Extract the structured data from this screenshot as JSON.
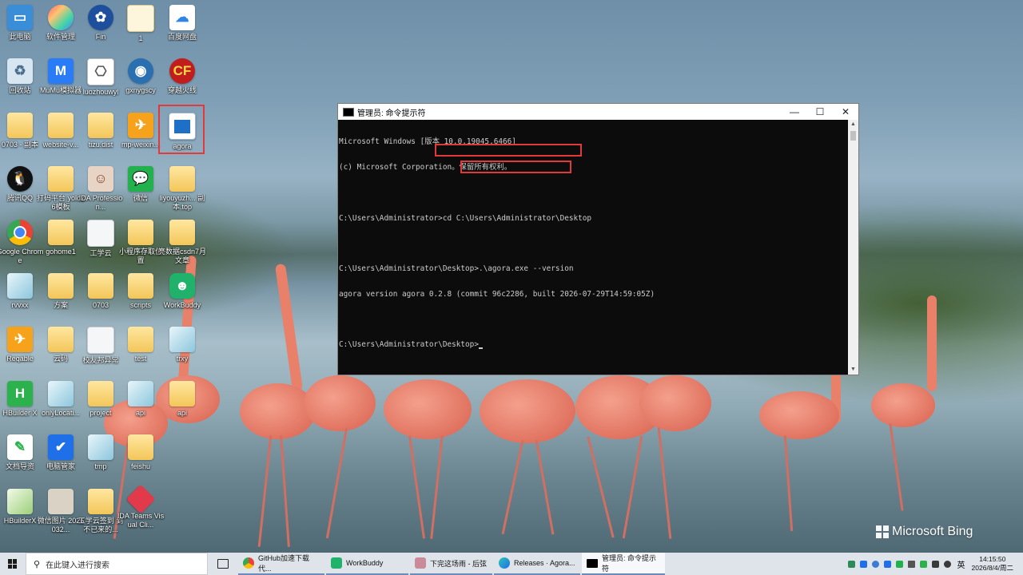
{
  "desktop": {
    "icons": [
      {
        "label": "此电脑"
      },
      {
        "label": "软件管理"
      },
      {
        "label": "Fin"
      },
      {
        "label": "1"
      },
      {
        "label": "百度网盘"
      },
      {
        "label": "回收站"
      },
      {
        "label": "MuMu模拟器"
      },
      {
        "label": "luozhouwyl"
      },
      {
        "label": "gxnygscy"
      },
      {
        "label": "穿越火线"
      },
      {
        "label": "0703 - 副本"
      },
      {
        "label": "website-v..."
      },
      {
        "label": "tizu.dist"
      },
      {
        "label": "mp-weixin..."
      },
      {
        "label": "agora"
      },
      {
        "label": "腾讯QQ"
      },
      {
        "label": "打码平台 yolo26模板"
      },
      {
        "label": "IDA Profession..."
      },
      {
        "label": "微信"
      },
      {
        "label": "liyouyuzh... 副本.top"
      },
      {
        "label": "Google Chrome"
      },
      {
        "label": "gohome1"
      },
      {
        "label": "工学云"
      },
      {
        "label": "小程序存取位置"
      },
      {
        "label": "亮数据csdn7月文章"
      },
      {
        "label": "rvvxx"
      },
      {
        "label": "方案"
      },
      {
        "label": "0703"
      },
      {
        "label": "scripts"
      },
      {
        "label": "WorkBuddy"
      },
      {
        "label": "Reqable"
      },
      {
        "label": "云码"
      },
      {
        "label": "校友邦异常"
      },
      {
        "label": "test"
      },
      {
        "label": "trxy"
      },
      {
        "label": "HBuilder X"
      },
      {
        "label": "onlyLocati..."
      },
      {
        "label": "project"
      },
      {
        "label": "api"
      },
      {
        "label": "api"
      },
      {
        "label": "文档导资"
      },
      {
        "label": "电脑管家"
      },
      {
        "label": "tmp"
      },
      {
        "label": "feishu"
      },
      {
        "label": "HBuilderX"
      },
      {
        "label": "微信图片 2026032..."
      },
      {
        "label": "工学云签到 到不已来的..."
      },
      {
        "label": "IDA Teams Visual Cli..."
      }
    ],
    "watermark": "Microsoft Bing"
  },
  "cmd": {
    "title": "管理员: 命令提示符",
    "minimize": "—",
    "maximize": "☐",
    "close": "✕",
    "lines": [
      "Microsoft Windows [版本 10.0.19045.6466]",
      "(c) Microsoft Corporation。保留所有权利。",
      "",
      "C:\\Users\\Administrator>cd C:\\Users\\Administrator\\Desktop",
      "",
      "C:\\Users\\Administrator\\Desktop>.\\agora.exe --version",
      "agora version agora 0.2.8 (commit 96c2286, built 2026-07-29T14:59:05Z)",
      "",
      "C:\\Users\\Administrator\\Desktop>"
    ]
  },
  "taskbar": {
    "search_placeholder": "在此键入进行搜索",
    "tasks": [
      {
        "label": "GitHub加速下载代..."
      },
      {
        "label": "WorkBuddy"
      },
      {
        "label": "下完这场雨 - 后弦"
      },
      {
        "label": "Releases · Agora..."
      },
      {
        "label": "管理员: 命令提示符"
      }
    ],
    "lang": "英",
    "time": "14:15:50",
    "date": "2026/8/4/周二"
  },
  "colors": {
    "highlight": "#e23a3a",
    "terminal_bg": "#0c0c0c",
    "terminal_fg": "#cccccc",
    "taskbar_bg": "#dfe4ea"
  }
}
